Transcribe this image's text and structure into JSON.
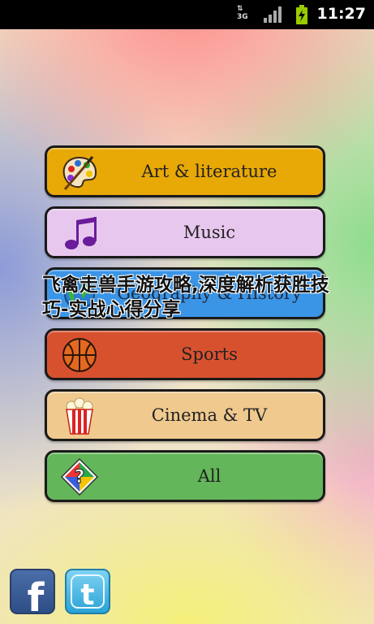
{
  "status_bar": {
    "network": "3G",
    "time": "11:27"
  },
  "menu": {
    "items": [
      {
        "label": "Art & literature",
        "color": "#e8a806",
        "icon": "palette-icon"
      },
      {
        "label": "Music",
        "color": "#e8c7ee",
        "icon": "music-note-icon"
      },
      {
        "label": "Geography & History",
        "color": "#3b95e6",
        "icon": "globe-icon"
      },
      {
        "label": "Sports",
        "color": "#d8512f",
        "icon": "basketball-icon"
      },
      {
        "label": "Cinema & TV",
        "color": "#f0c98f",
        "icon": "popcorn-icon"
      },
      {
        "label": "All",
        "color": "#63b65a",
        "icon": "question-diamond-icon"
      }
    ]
  },
  "overlay_text": "飞禽走兽手游攻略,深度解析获胜技巧-实战心得分享",
  "social": {
    "facebook": "f",
    "twitter": "t"
  }
}
